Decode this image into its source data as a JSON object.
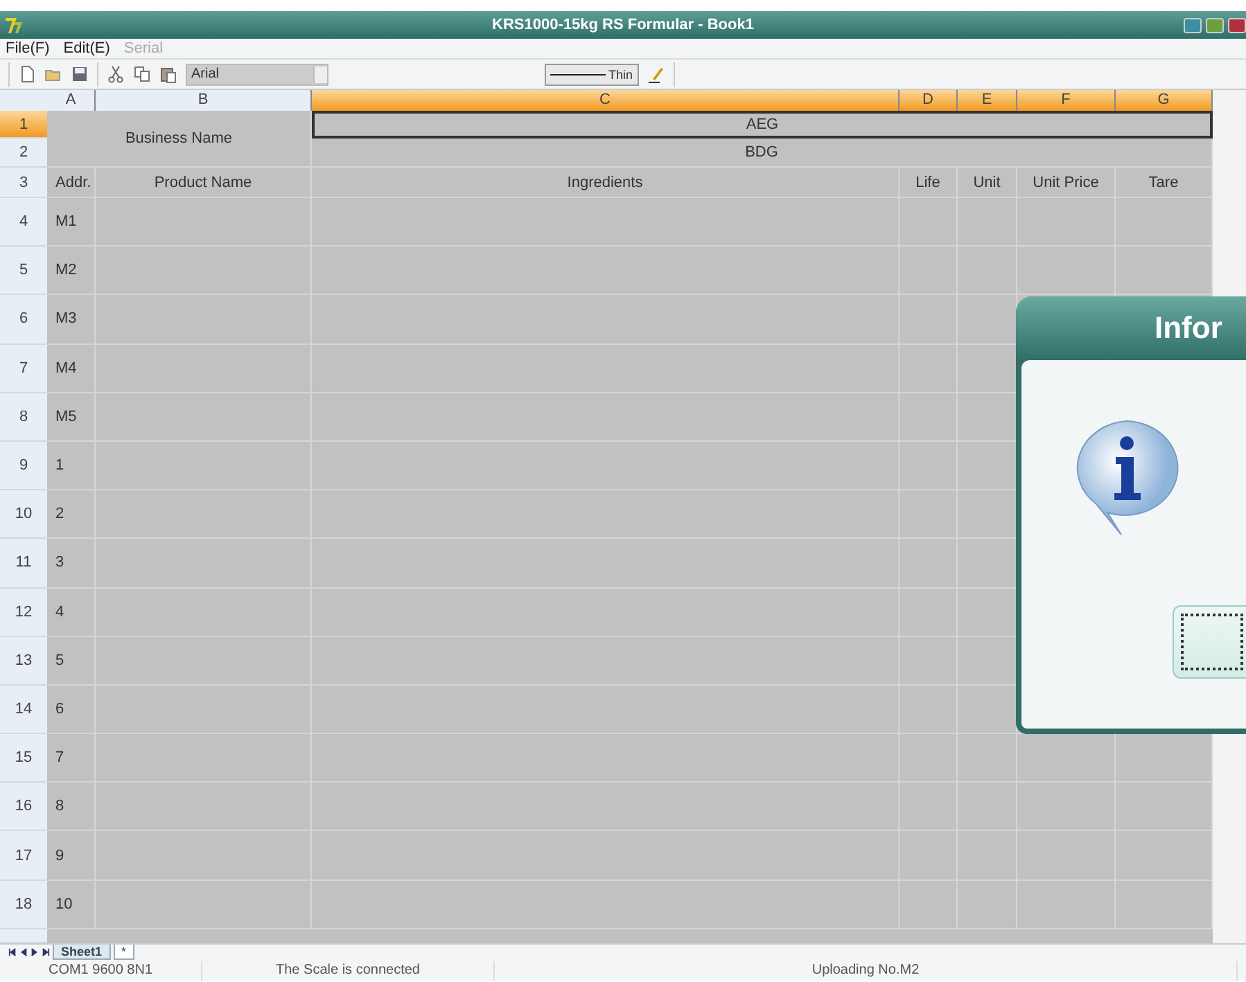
{
  "window": {
    "title": "KRS1000-15kg RS Formular - Book1"
  },
  "menu": [
    {
      "label": "File(F)",
      "disabled": false
    },
    {
      "label": "Edit(E)",
      "disabled": false
    },
    {
      "label": "Serial",
      "disabled": true
    }
  ],
  "toolbar": {
    "font": "Arial",
    "line_style": "Thin"
  },
  "columns": [
    {
      "label": "A",
      "selected": false
    },
    {
      "label": "B",
      "selected": false
    },
    {
      "label": "C",
      "selected": true
    },
    {
      "label": "D",
      "selected": true
    },
    {
      "label": "E",
      "selected": true
    },
    {
      "label": "F",
      "selected": true
    },
    {
      "label": "G",
      "selected": true
    }
  ],
  "header_rows": [
    {
      "number": "1",
      "selected": true
    },
    {
      "number": "2",
      "selected": false
    },
    {
      "number": "3",
      "selected": false
    }
  ],
  "business_name": "Business Name",
  "merged": [
    "AEG",
    "BDG"
  ],
  "headings": [
    "Addr.",
    "Product Name",
    "Ingredients",
    "Life",
    "Unit",
    "Unit Price",
    "Tare"
  ],
  "rows": [
    {
      "number": "4",
      "addr": "M1"
    },
    {
      "number": "5",
      "addr": "M2"
    },
    {
      "number": "6",
      "addr": "M3"
    },
    {
      "number": "7",
      "addr": "M4"
    },
    {
      "number": "8",
      "addr": "M5"
    },
    {
      "number": "9",
      "addr": "1"
    },
    {
      "number": "10",
      "addr": "2"
    },
    {
      "number": "11",
      "addr": "3"
    },
    {
      "number": "12",
      "addr": "4"
    },
    {
      "number": "13",
      "addr": "5"
    },
    {
      "number": "14",
      "addr": "6"
    },
    {
      "number": "15",
      "addr": "7"
    },
    {
      "number": "16",
      "addr": "8"
    },
    {
      "number": "17",
      "addr": "9"
    },
    {
      "number": "18",
      "addr": "10"
    }
  ],
  "sheet_tabs": [
    {
      "label": "Sheet1",
      "selected": true
    },
    {
      "label": "*",
      "selected": false
    }
  ],
  "status_bar": [
    "COM1 9600 8N1",
    "The Scale is connected",
    "Uploading No.M2"
  ],
  "dialog": {
    "title": "Infor"
  }
}
